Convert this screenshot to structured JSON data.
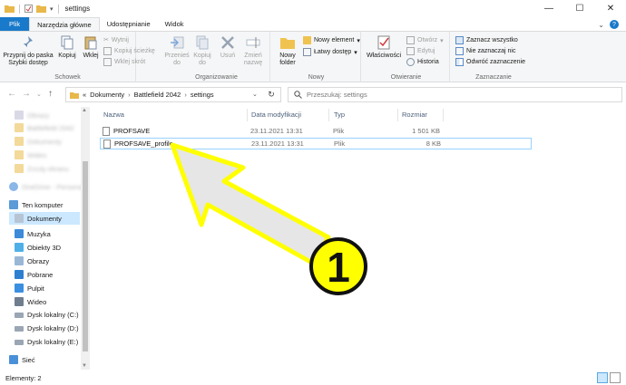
{
  "window": {
    "title": "settings",
    "controls": [
      "—",
      "☐",
      "✕"
    ]
  },
  "tabs": [
    {
      "label": "Plik"
    },
    {
      "label": "Narzędzia główne"
    },
    {
      "label": "Udostępnianie"
    },
    {
      "label": "Widok"
    }
  ],
  "ribbon": {
    "pin_label": "Przypnij do paska Szybki dostęp",
    "copy_label": "Kopiuj",
    "paste_label": "Wklej",
    "cut_label": "Wytnij",
    "copy_path_label": "Kopiuj ścieżkę",
    "paste_shortcut_label": "Wklej skrót",
    "group_clipboard": "Schowek",
    "move_label": "Przenieś do",
    "copy_to_label": "Kopiuj do",
    "delete_label": "Usuń",
    "rename_label": "Zmień nazwę",
    "group_organize": "Organizowanie",
    "new_folder_label": "Nowy folder",
    "new_item_label": "Nowy element",
    "easy_access_label": "Łatwy dostęp",
    "group_new": "Nowy",
    "properties_label": "Właściwości",
    "open_label": "Otwórz",
    "edit_label": "Edytuj",
    "history_label": "Historia",
    "group_open": "Otwieranie",
    "select_all_label": "Zaznacz wszystko",
    "select_none_label": "Nie zaznaczaj nic",
    "invert_selection_label": "Odwróć zaznaczenie",
    "group_select": "Zaznaczanie"
  },
  "address": {
    "prefix": "«",
    "crumbs": [
      "Dokumenty",
      "Battlefield 2042",
      "settings"
    ],
    "search_placeholder": "Przeszukaj: settings"
  },
  "nav": {
    "blurred": [
      "Obrazy",
      "Battlefield 2042",
      "Dokumenty",
      "Wideo",
      "Zrzuty ekranu",
      "OneDrive - Personal"
    ],
    "this_pc": "Ten komputer",
    "items": [
      "Dokumenty",
      "Muzyka",
      "Obiekty 3D",
      "Obrazy",
      "Pobrane",
      "Pulpit",
      "Wideo",
      "Dysk lokalny (C:)",
      "Dysk lokalny (D:)",
      "Dysk lokalny (E:)"
    ],
    "network": "Sieć"
  },
  "columns": {
    "name": "Nazwa",
    "date": "Data modyfikacji",
    "type": "Typ",
    "size": "Rozmiar"
  },
  "files": [
    {
      "name": "PROFSAVE",
      "date": "23.11.2021 13:31",
      "type": "Plik",
      "size": "1 501 KB"
    },
    {
      "name": "PROFSAVE_profile",
      "date": "23.11.2021 13:31",
      "type": "Plik",
      "size": "8 KB"
    }
  ],
  "status": {
    "count": "Elementy: 2"
  },
  "annotation": {
    "number": "1",
    "arrow_color": "#ffff00",
    "badge_color": "#ffff00"
  },
  "colors": {
    "accent": "#1979ca",
    "selection": "#cce8ff"
  }
}
